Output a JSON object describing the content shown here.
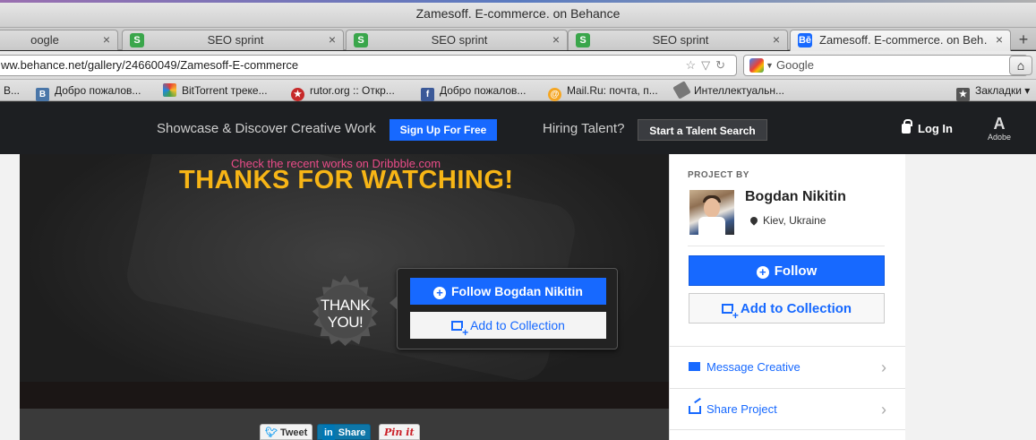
{
  "window": {
    "title": "Zamesoff. E-commerce. on Behance"
  },
  "tabs": [
    {
      "label": "oogle",
      "favicon": "none"
    },
    {
      "label": "SEO sprint",
      "favicon": "seo-icon"
    },
    {
      "label": "SEO sprint",
      "favicon": "seo-icon"
    },
    {
      "label": "SEO sprint",
      "favicon": "seo-icon"
    },
    {
      "label": "Zamesoff. E-commerce. on Beh…",
      "favicon": "behance-icon",
      "active": true
    }
  ],
  "tab_close": "×",
  "new_tab": "+",
  "navbar": {
    "url": "ww.behance.net/gallery/24660049/Zamesoff-E-commerce",
    "search_placeholder": "Google"
  },
  "bookmarks": [
    {
      "label": "В..."
    },
    {
      "label": "Добро пожалов..."
    },
    {
      "label": "BitTorrent треке..."
    },
    {
      "label": "rutor.org :: Откр..."
    },
    {
      "label": "Добро пожалов..."
    },
    {
      "label": "Mail.Ru: почта, п..."
    },
    {
      "label": "Интеллектуальн..."
    },
    {
      "label": "Закладки"
    }
  ],
  "behance": {
    "tagline": "Showcase & Discover Creative Work",
    "signup": "Sign Up For Free",
    "hiring": "Hiring Talent?",
    "talent_search": "Start a Talent Search",
    "login": "Log In",
    "adobe": "Adobe",
    "accent": "#1769ff"
  },
  "project": {
    "dribbble_text": "Check the recent works on Dribbble.com",
    "thanks": "THANKS FOR WATCHING!",
    "badge_line1": "THANK",
    "badge_line2": "YOU!",
    "follow_button": "Follow Bogdan Nikitin",
    "collection_button": "Add to Collection"
  },
  "share": {
    "tweet": "Tweet",
    "linkedin": "Share",
    "pinterest": "Pin it"
  },
  "sidebar": {
    "project_by": "PROJECT BY",
    "name": "Bogdan Nikitin",
    "location": "Kiev, Ukraine",
    "follow": "Follow",
    "add_collection": "Add to Collection",
    "message": "Message Creative",
    "share_project": "Share Project"
  }
}
